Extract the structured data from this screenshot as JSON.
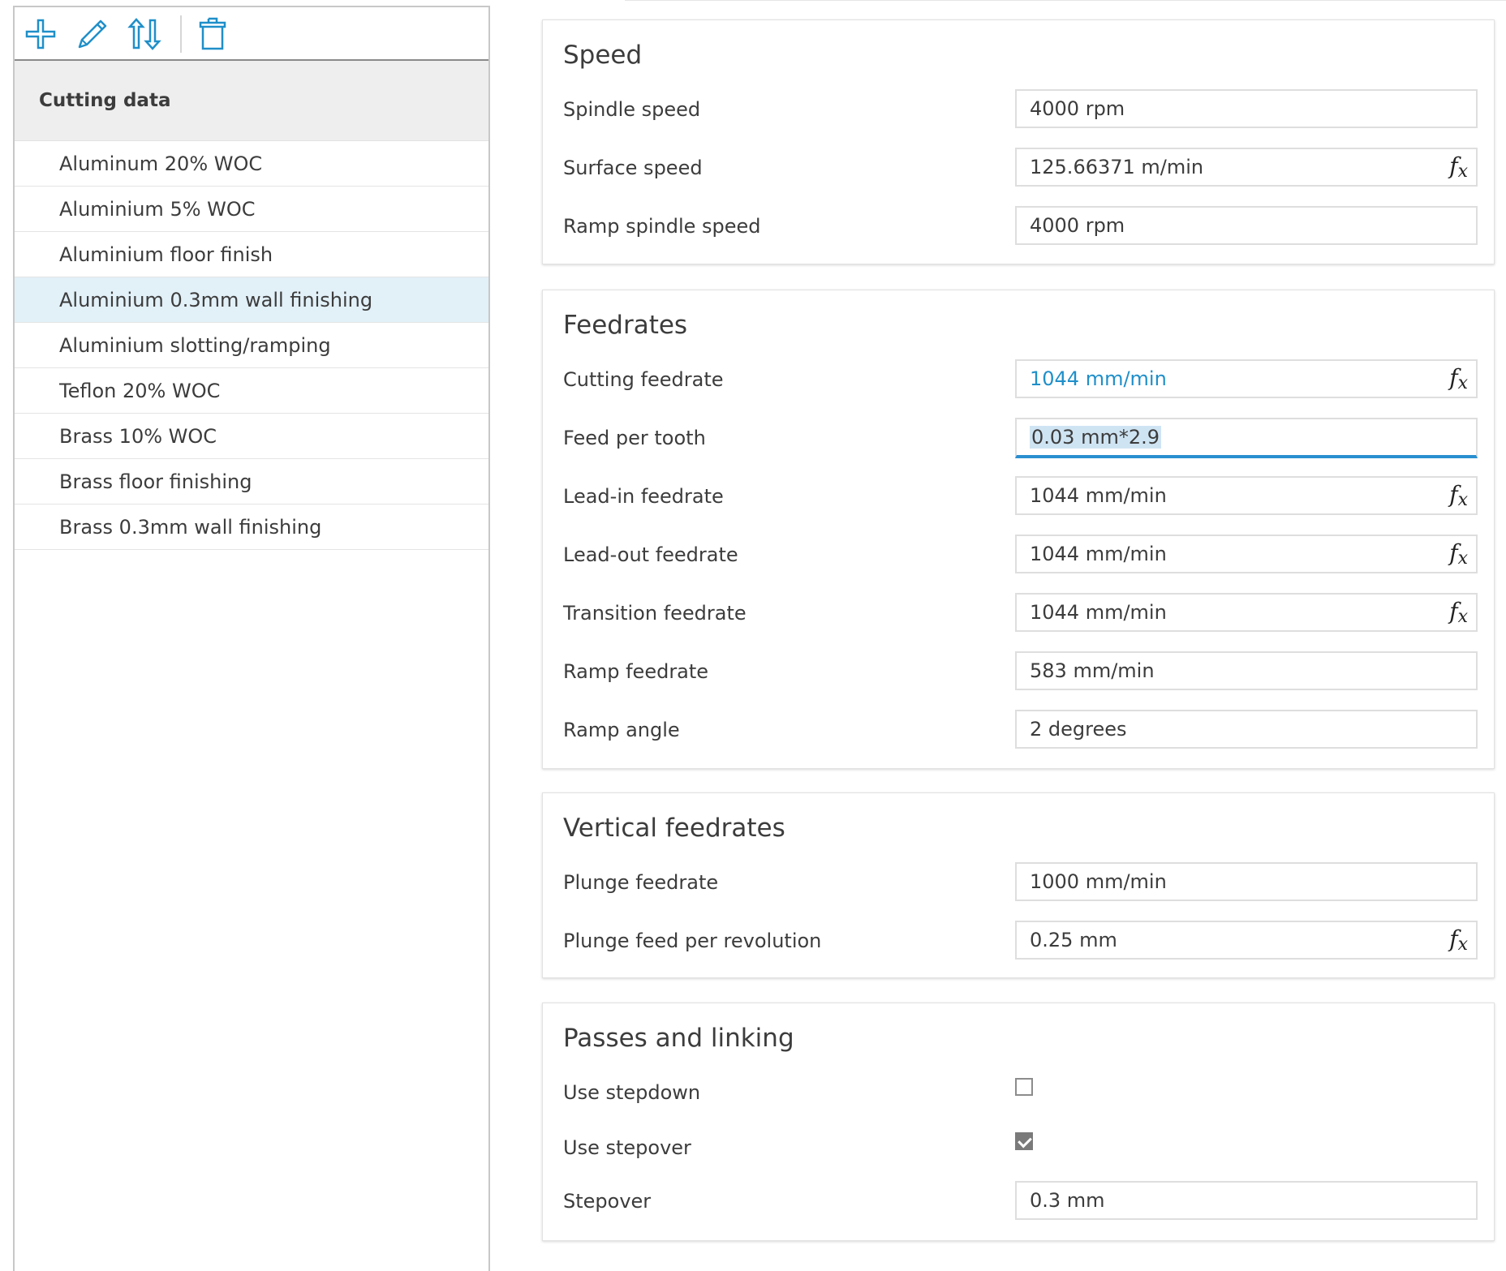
{
  "toolbar": {
    "icons": [
      "plus-icon",
      "pencil-icon",
      "sort-arrows-icon",
      "trash-icon"
    ],
    "accent": "#1f8fc9"
  },
  "list": {
    "header": "Cutting data",
    "items": [
      "Aluminum 20% WOC",
      "Aluminium 5% WOC",
      "Aluminium floor finish",
      "Aluminium 0.3mm wall finishing",
      "Aluminium slotting/ramping",
      "Teflon 20% WOC",
      "Brass 10% WOC",
      "Brass floor finishing",
      "Brass 0.3mm wall finishing"
    ],
    "selected_index": 3,
    "selected_bg": "#e2f0f8"
  },
  "speed": {
    "title": "Speed",
    "rows": [
      {
        "label": "Spindle speed",
        "value": "4000 rpm"
      },
      {
        "label": "Surface speed",
        "value": "125.66371 m/min"
      },
      {
        "label": "Ramp spindle speed",
        "value": "4000 rpm"
      }
    ]
  },
  "feedrates": {
    "title": "Feedrates",
    "rows": [
      {
        "label": "Cutting feedrate",
        "value": "1044 mm/min"
      },
      {
        "label": "Feed per tooth",
        "value": "0.03 mm*2.9"
      },
      {
        "label": "Lead-in feedrate",
        "value": "1044 mm/min"
      },
      {
        "label": "Lead-out feedrate",
        "value": "1044 mm/min"
      },
      {
        "label": "Transition feedrate",
        "value": "1044 mm/min"
      },
      {
        "label": "Ramp feedrate",
        "value": "583 mm/min"
      },
      {
        "label": "Ramp angle",
        "value": "2 degrees"
      }
    ]
  },
  "vertical": {
    "title": "Vertical feedrates",
    "rows": [
      {
        "label": "Plunge feedrate",
        "value": "1000 mm/min"
      },
      {
        "label": "Plunge feed per revolution",
        "value": "0.25 mm"
      }
    ]
  },
  "passes": {
    "title": "Passes and linking",
    "rows": [
      {
        "label": "Use stepdown",
        "checked": false
      },
      {
        "label": "Use stepover",
        "checked": true
      },
      {
        "label": "Stepover",
        "value": "0.3 mm"
      }
    ]
  },
  "fx": {
    "f": "f",
    "x": "x"
  }
}
